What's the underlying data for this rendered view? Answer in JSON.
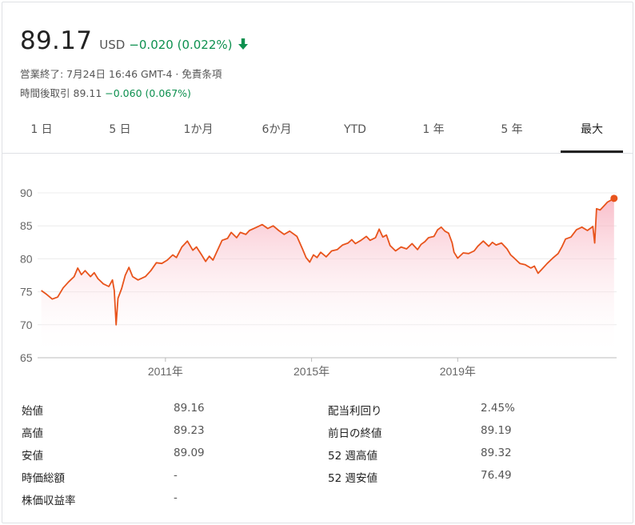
{
  "header": {
    "price": "89.17",
    "currency": "USD",
    "change": "−0.020 (0.022%)",
    "direction_icon": "arrow-down-icon",
    "status": "営業終了: 7月24日 16:46 GMT-4 · 免責条項",
    "after_hours_label": "時間後取引",
    "after_hours_price": "89.11",
    "after_hours_change": "−0.060 (0.067%)"
  },
  "tabs": [
    "1 日",
    "5 日",
    "1か月",
    "6か月",
    "YTD",
    "1 年",
    "5 年",
    "最大"
  ],
  "active_tab": 7,
  "colors": {
    "line": "#e8541c",
    "negative": "#0d904f",
    "fill": "#fde2e6"
  },
  "chart_data": {
    "type": "area",
    "ylim": [
      65,
      90
    ],
    "y_ticks": [
      "90",
      "85",
      "80",
      "75",
      "70",
      "65"
    ],
    "x_ticks": [
      "2011年",
      "2015年",
      "2019年"
    ],
    "x_tick_years": [
      2011,
      2015,
      2019
    ],
    "grid": true,
    "series": [
      {
        "points": [
          [
            2007.6,
            75.2
          ],
          [
            2007.75,
            74.6
          ],
          [
            2007.9,
            73.9
          ],
          [
            2008.05,
            74.2
          ],
          [
            2008.2,
            75.6
          ],
          [
            2008.35,
            76.5
          ],
          [
            2008.5,
            77.3
          ],
          [
            2008.6,
            78.6
          ],
          [
            2008.7,
            77.6
          ],
          [
            2008.8,
            78.2
          ],
          [
            2008.95,
            77.3
          ],
          [
            2009.05,
            77.9
          ],
          [
            2009.15,
            77.0
          ],
          [
            2009.3,
            76.2
          ],
          [
            2009.45,
            75.8
          ],
          [
            2009.55,
            76.8
          ],
          [
            2009.6,
            75.2
          ],
          [
            2009.65,
            70.0
          ],
          [
            2009.7,
            74.0
          ],
          [
            2009.8,
            75.5
          ],
          [
            2009.9,
            77.5
          ],
          [
            2010.0,
            78.7
          ],
          [
            2010.1,
            77.3
          ],
          [
            2010.25,
            76.8
          ],
          [
            2010.45,
            77.3
          ],
          [
            2010.6,
            78.2
          ],
          [
            2010.75,
            79.4
          ],
          [
            2010.9,
            79.3
          ],
          [
            2011.05,
            79.8
          ],
          [
            2011.2,
            80.6
          ],
          [
            2011.3,
            80.2
          ],
          [
            2011.45,
            81.8
          ],
          [
            2011.6,
            82.7
          ],
          [
            2011.75,
            81.3
          ],
          [
            2011.85,
            81.8
          ],
          [
            2012.0,
            80.5
          ],
          [
            2012.1,
            79.6
          ],
          [
            2012.2,
            80.4
          ],
          [
            2012.3,
            79.8
          ],
          [
            2012.4,
            81.0
          ],
          [
            2012.55,
            82.8
          ],
          [
            2012.7,
            83.1
          ],
          [
            2012.8,
            84.0
          ],
          [
            2012.95,
            83.2
          ],
          [
            2013.05,
            84.0
          ],
          [
            2013.2,
            83.7
          ],
          [
            2013.3,
            84.3
          ],
          [
            2013.5,
            84.8
          ],
          [
            2013.65,
            85.2
          ],
          [
            2013.8,
            84.6
          ],
          [
            2013.95,
            85.0
          ],
          [
            2014.1,
            84.3
          ],
          [
            2014.25,
            83.7
          ],
          [
            2014.4,
            84.2
          ],
          [
            2014.6,
            83.4
          ],
          [
            2014.75,
            81.5
          ],
          [
            2014.85,
            80.2
          ],
          [
            2014.95,
            79.5
          ],
          [
            2015.05,
            80.6
          ],
          [
            2015.15,
            80.2
          ],
          [
            2015.25,
            81.0
          ],
          [
            2015.4,
            80.3
          ],
          [
            2015.55,
            81.2
          ],
          [
            2015.7,
            81.4
          ],
          [
            2015.85,
            82.1
          ],
          [
            2016.0,
            82.4
          ],
          [
            2016.1,
            82.9
          ],
          [
            2016.2,
            82.3
          ],
          [
            2016.35,
            82.8
          ],
          [
            2016.5,
            83.4
          ],
          [
            2016.6,
            82.8
          ],
          [
            2016.75,
            83.2
          ],
          [
            2016.85,
            84.5
          ],
          [
            2016.95,
            83.3
          ],
          [
            2017.05,
            83.6
          ],
          [
            2017.15,
            82.0
          ],
          [
            2017.3,
            81.2
          ],
          [
            2017.45,
            81.8
          ],
          [
            2017.6,
            81.5
          ],
          [
            2017.75,
            82.3
          ],
          [
            2017.9,
            81.4
          ],
          [
            2018.0,
            82.2
          ],
          [
            2018.1,
            82.6
          ],
          [
            2018.2,
            83.2
          ],
          [
            2018.35,
            83.4
          ],
          [
            2018.45,
            84.4
          ],
          [
            2018.55,
            84.8
          ],
          [
            2018.65,
            84.2
          ],
          [
            2018.75,
            83.9
          ],
          [
            2018.85,
            82.4
          ],
          [
            2018.9,
            81.0
          ],
          [
            2019.0,
            80.1
          ],
          [
            2019.15,
            80.9
          ],
          [
            2019.3,
            80.8
          ],
          [
            2019.45,
            81.2
          ],
          [
            2019.55,
            81.9
          ],
          [
            2019.7,
            82.7
          ],
          [
            2019.85,
            81.9
          ],
          [
            2019.95,
            82.5
          ],
          [
            2020.05,
            82.1
          ],
          [
            2020.2,
            82.4
          ],
          [
            2020.35,
            81.5
          ],
          [
            2020.45,
            80.6
          ],
          [
            2020.55,
            80.1
          ],
          [
            2020.7,
            79.3
          ],
          [
            2020.85,
            79.1
          ],
          [
            2021.0,
            78.6
          ],
          [
            2021.1,
            78.9
          ],
          [
            2021.2,
            77.8
          ],
          [
            2021.3,
            78.4
          ],
          [
            2021.45,
            79.3
          ],
          [
            2021.6,
            80.1
          ],
          [
            2021.75,
            80.8
          ],
          [
            2021.85,
            81.8
          ],
          [
            2021.95,
            83.0
          ],
          [
            2022.1,
            83.3
          ],
          [
            2022.25,
            84.4
          ],
          [
            2022.4,
            84.8
          ],
          [
            2022.55,
            84.3
          ],
          [
            2022.7,
            84.9
          ],
          [
            2022.75,
            82.4
          ],
          [
            2022.8,
            87.6
          ],
          [
            2022.9,
            87.4
          ],
          [
            2023.0,
            88.0
          ],
          [
            2023.1,
            88.6
          ],
          [
            2023.2,
            88.9
          ],
          [
            2023.28,
            89.17
          ]
        ]
      }
    ]
  },
  "stats": [
    {
      "label": "始値",
      "value": "89.16"
    },
    {
      "label": "高値",
      "value": "89.23"
    },
    {
      "label": "安値",
      "value": "89.09"
    },
    {
      "label": "時価総額",
      "value": "-"
    },
    {
      "label": "株価収益率",
      "value": "-"
    },
    {
      "label": "配当利回り",
      "value": "2.45%"
    },
    {
      "label": "前日の終値",
      "value": "89.19"
    },
    {
      "label": "52 週高値",
      "value": "89.32"
    },
    {
      "label": "52 週安値",
      "value": "76.49"
    }
  ]
}
